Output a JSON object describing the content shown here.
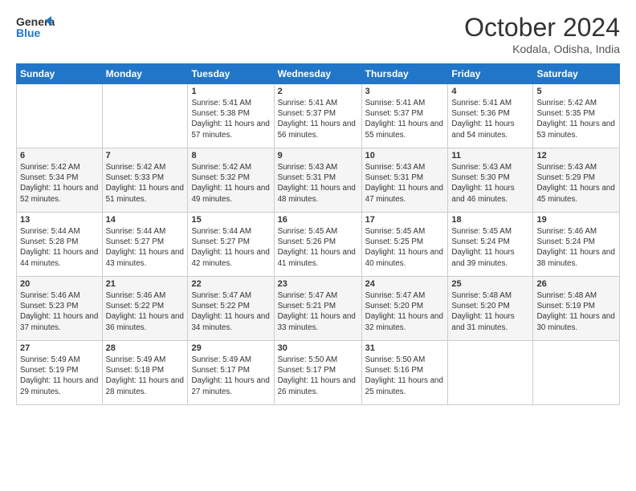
{
  "logo": {
    "line1": "General",
    "line2": "Blue"
  },
  "title": "October 2024",
  "location": "Kodala, Odisha, India",
  "days_of_week": [
    "Sunday",
    "Monday",
    "Tuesday",
    "Wednesday",
    "Thursday",
    "Friday",
    "Saturday"
  ],
  "weeks": [
    [
      {
        "day": "",
        "text": ""
      },
      {
        "day": "",
        "text": ""
      },
      {
        "day": "1",
        "text": "Sunrise: 5:41 AM\nSunset: 5:38 PM\nDaylight: 11 hours and 57 minutes."
      },
      {
        "day": "2",
        "text": "Sunrise: 5:41 AM\nSunset: 5:37 PM\nDaylight: 11 hours and 56 minutes."
      },
      {
        "day": "3",
        "text": "Sunrise: 5:41 AM\nSunset: 5:37 PM\nDaylight: 11 hours and 55 minutes."
      },
      {
        "day": "4",
        "text": "Sunrise: 5:41 AM\nSunset: 5:36 PM\nDaylight: 11 hours and 54 minutes."
      },
      {
        "day": "5",
        "text": "Sunrise: 5:42 AM\nSunset: 5:35 PM\nDaylight: 11 hours and 53 minutes."
      }
    ],
    [
      {
        "day": "6",
        "text": "Sunrise: 5:42 AM\nSunset: 5:34 PM\nDaylight: 11 hours and 52 minutes."
      },
      {
        "day": "7",
        "text": "Sunrise: 5:42 AM\nSunset: 5:33 PM\nDaylight: 11 hours and 51 minutes."
      },
      {
        "day": "8",
        "text": "Sunrise: 5:42 AM\nSunset: 5:32 PM\nDaylight: 11 hours and 49 minutes."
      },
      {
        "day": "9",
        "text": "Sunrise: 5:43 AM\nSunset: 5:31 PM\nDaylight: 11 hours and 48 minutes."
      },
      {
        "day": "10",
        "text": "Sunrise: 5:43 AM\nSunset: 5:31 PM\nDaylight: 11 hours and 47 minutes."
      },
      {
        "day": "11",
        "text": "Sunrise: 5:43 AM\nSunset: 5:30 PM\nDaylight: 11 hours and 46 minutes."
      },
      {
        "day": "12",
        "text": "Sunrise: 5:43 AM\nSunset: 5:29 PM\nDaylight: 11 hours and 45 minutes."
      }
    ],
    [
      {
        "day": "13",
        "text": "Sunrise: 5:44 AM\nSunset: 5:28 PM\nDaylight: 11 hours and 44 minutes."
      },
      {
        "day": "14",
        "text": "Sunrise: 5:44 AM\nSunset: 5:27 PM\nDaylight: 11 hours and 43 minutes."
      },
      {
        "day": "15",
        "text": "Sunrise: 5:44 AM\nSunset: 5:27 PM\nDaylight: 11 hours and 42 minutes."
      },
      {
        "day": "16",
        "text": "Sunrise: 5:45 AM\nSunset: 5:26 PM\nDaylight: 11 hours and 41 minutes."
      },
      {
        "day": "17",
        "text": "Sunrise: 5:45 AM\nSunset: 5:25 PM\nDaylight: 11 hours and 40 minutes."
      },
      {
        "day": "18",
        "text": "Sunrise: 5:45 AM\nSunset: 5:24 PM\nDaylight: 11 hours and 39 minutes."
      },
      {
        "day": "19",
        "text": "Sunrise: 5:46 AM\nSunset: 5:24 PM\nDaylight: 11 hours and 38 minutes."
      }
    ],
    [
      {
        "day": "20",
        "text": "Sunrise: 5:46 AM\nSunset: 5:23 PM\nDaylight: 11 hours and 37 minutes."
      },
      {
        "day": "21",
        "text": "Sunrise: 5:46 AM\nSunset: 5:22 PM\nDaylight: 11 hours and 36 minutes."
      },
      {
        "day": "22",
        "text": "Sunrise: 5:47 AM\nSunset: 5:22 PM\nDaylight: 11 hours and 34 minutes."
      },
      {
        "day": "23",
        "text": "Sunrise: 5:47 AM\nSunset: 5:21 PM\nDaylight: 11 hours and 33 minutes."
      },
      {
        "day": "24",
        "text": "Sunrise: 5:47 AM\nSunset: 5:20 PM\nDaylight: 11 hours and 32 minutes."
      },
      {
        "day": "25",
        "text": "Sunrise: 5:48 AM\nSunset: 5:20 PM\nDaylight: 11 hours and 31 minutes."
      },
      {
        "day": "26",
        "text": "Sunrise: 5:48 AM\nSunset: 5:19 PM\nDaylight: 11 hours and 30 minutes."
      }
    ],
    [
      {
        "day": "27",
        "text": "Sunrise: 5:49 AM\nSunset: 5:19 PM\nDaylight: 11 hours and 29 minutes."
      },
      {
        "day": "28",
        "text": "Sunrise: 5:49 AM\nSunset: 5:18 PM\nDaylight: 11 hours and 28 minutes."
      },
      {
        "day": "29",
        "text": "Sunrise: 5:49 AM\nSunset: 5:17 PM\nDaylight: 11 hours and 27 minutes."
      },
      {
        "day": "30",
        "text": "Sunrise: 5:50 AM\nSunset: 5:17 PM\nDaylight: 11 hours and 26 minutes."
      },
      {
        "day": "31",
        "text": "Sunrise: 5:50 AM\nSunset: 5:16 PM\nDaylight: 11 hours and 25 minutes."
      },
      {
        "day": "",
        "text": ""
      },
      {
        "day": "",
        "text": ""
      }
    ]
  ]
}
